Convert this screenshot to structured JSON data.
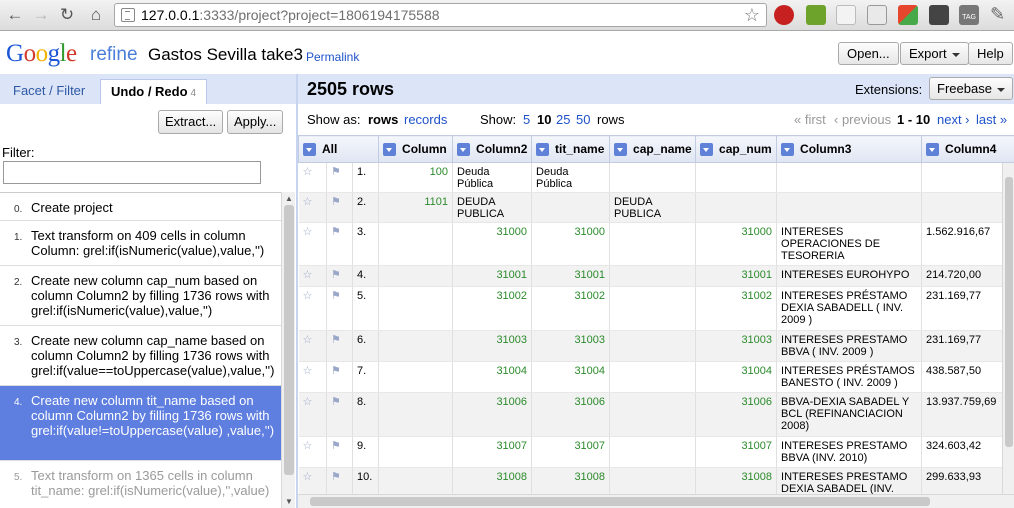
{
  "browser": {
    "url_host": "127.0.0.1",
    "url_rest": ":3333/project?project=1806194175588",
    "ext_tag_label": "TAG"
  },
  "app": {
    "logo_google": [
      "G",
      "o",
      "o",
      "g",
      "l",
      "e"
    ],
    "logo_refine": "refine",
    "project_name": "Gastos Sevilla take3",
    "permalink": "Permalink",
    "open_button": "Open...",
    "export_button": "Export",
    "help_button": "Help"
  },
  "left": {
    "tab_facet": "Facet / Filter",
    "tab_undo": "Undo / Redo",
    "undo_count": "4",
    "extract_button": "Extract...",
    "apply_button": "Apply...",
    "filter_label": "Filter:",
    "history": [
      {
        "num": "0.",
        "text": "Create project"
      },
      {
        "num": "1.",
        "text": "Text transform on 409 cells in column Column: grel:if(isNumeric(value),value,'')"
      },
      {
        "num": "2.",
        "text": "Create new column cap_num based on column Column2 by filling 1736 rows with grel:if(isNumeric(value),value,'')"
      },
      {
        "num": "3.",
        "text": "Create new column cap_name based on column Column2 by filling 1736 rows with grel:if(value==toUppercase(value),value,'')"
      },
      {
        "num": "4.",
        "text": "Create new column tit_name based on column Column2 by filling 1736 rows with grel:if(value!=toUppercase(value) ,value,'')"
      },
      {
        "num": "5.",
        "text": "Text transform on 1365 cells in column tit_name: grel:if(isNumeric(value),'',value)"
      }
    ]
  },
  "right": {
    "rows_count": "2505 rows",
    "extensions_label": "Extensions:",
    "freebase_button": "Freebase",
    "show_as_label": "Show as:",
    "show_rows": "rows",
    "show_records": "records",
    "show_label": "Show:",
    "page_sizes": [
      "5",
      "10",
      "25",
      "50"
    ],
    "page_size_current": "10",
    "rows_word": "rows",
    "pager_first": "« first",
    "pager_previous": "‹ previous",
    "pager_range": "1 - 10",
    "pager_next": "next ›",
    "pager_last": "last »",
    "columns": [
      "All",
      "Column",
      "Column2",
      "tit_name",
      "cap_name",
      "cap_num",
      "Column3",
      "Column4"
    ],
    "rows": [
      {
        "idx": "1.",
        "column": "100",
        "column2": "Deuda Pública",
        "tit_name": "Deuda Pública",
        "cap_name": "",
        "cap_num": "",
        "column3": "",
        "column4": ""
      },
      {
        "idx": "2.",
        "column": "1101",
        "column2": "DEUDA PUBLICA",
        "tit_name": "",
        "cap_name": "DEUDA PUBLICA",
        "cap_num": "",
        "column3": "",
        "column4": ""
      },
      {
        "idx": "3.",
        "column": "",
        "column2": "31000",
        "tit_name": "31000",
        "cap_name": "",
        "cap_num": "31000",
        "column3": "INTERESES OPERACIONES DE TESORERIA",
        "column4": "1.562.916,67"
      },
      {
        "idx": "4.",
        "column": "",
        "column2": "31001",
        "tit_name": "31001",
        "cap_name": "",
        "cap_num": "31001",
        "column3": "INTERESES EUROHYPO",
        "column4": "214.720,00"
      },
      {
        "idx": "5.",
        "column": "",
        "column2": "31002",
        "tit_name": "31002",
        "cap_name": "",
        "cap_num": "31002",
        "column3": "INTERESES PRÉSTAMO DEXIA SABADELL ( INV. 2009 )",
        "column4": "231.169,77"
      },
      {
        "idx": "6.",
        "column": "",
        "column2": "31003",
        "tit_name": "31003",
        "cap_name": "",
        "cap_num": "31003",
        "column3": "INTERESES PRESTAMO BBVA ( INV. 2009 )",
        "column4": "231.169,77"
      },
      {
        "idx": "7.",
        "column": "",
        "column2": "31004",
        "tit_name": "31004",
        "cap_name": "",
        "cap_num": "31004",
        "column3": "INTERESES PRÉSTAMOS BANESTO ( INV. 2009 )",
        "column4": "438.587,50"
      },
      {
        "idx": "8.",
        "column": "",
        "column2": "31006",
        "tit_name": "31006",
        "cap_name": "",
        "cap_num": "31006",
        "column3": "BBVA-DEXIA SABADEL Y BCL (REFINANCIACION 2008)",
        "column4": "13.937.759,69"
      },
      {
        "idx": "9.",
        "column": "",
        "column2": "31007",
        "tit_name": "31007",
        "cap_name": "",
        "cap_num": "31007",
        "column3": "INTERESES PRESTAMO BBVA (INV. 2010)",
        "column4": "324.603,42"
      },
      {
        "idx": "10.",
        "column": "",
        "column2": "31008",
        "tit_name": "31008",
        "cap_name": "",
        "cap_num": "31008",
        "column3": "INTERESES PRESTAMO DEXIA SABADEL (INV.",
        "column4": "299.633,93"
      }
    ]
  },
  "colors": {
    "accent_blue": "#dce5f8",
    "selected_history": "#5e7ee0",
    "number_green": "#2b8a2b",
    "link_blue": "#1e52c8"
  }
}
